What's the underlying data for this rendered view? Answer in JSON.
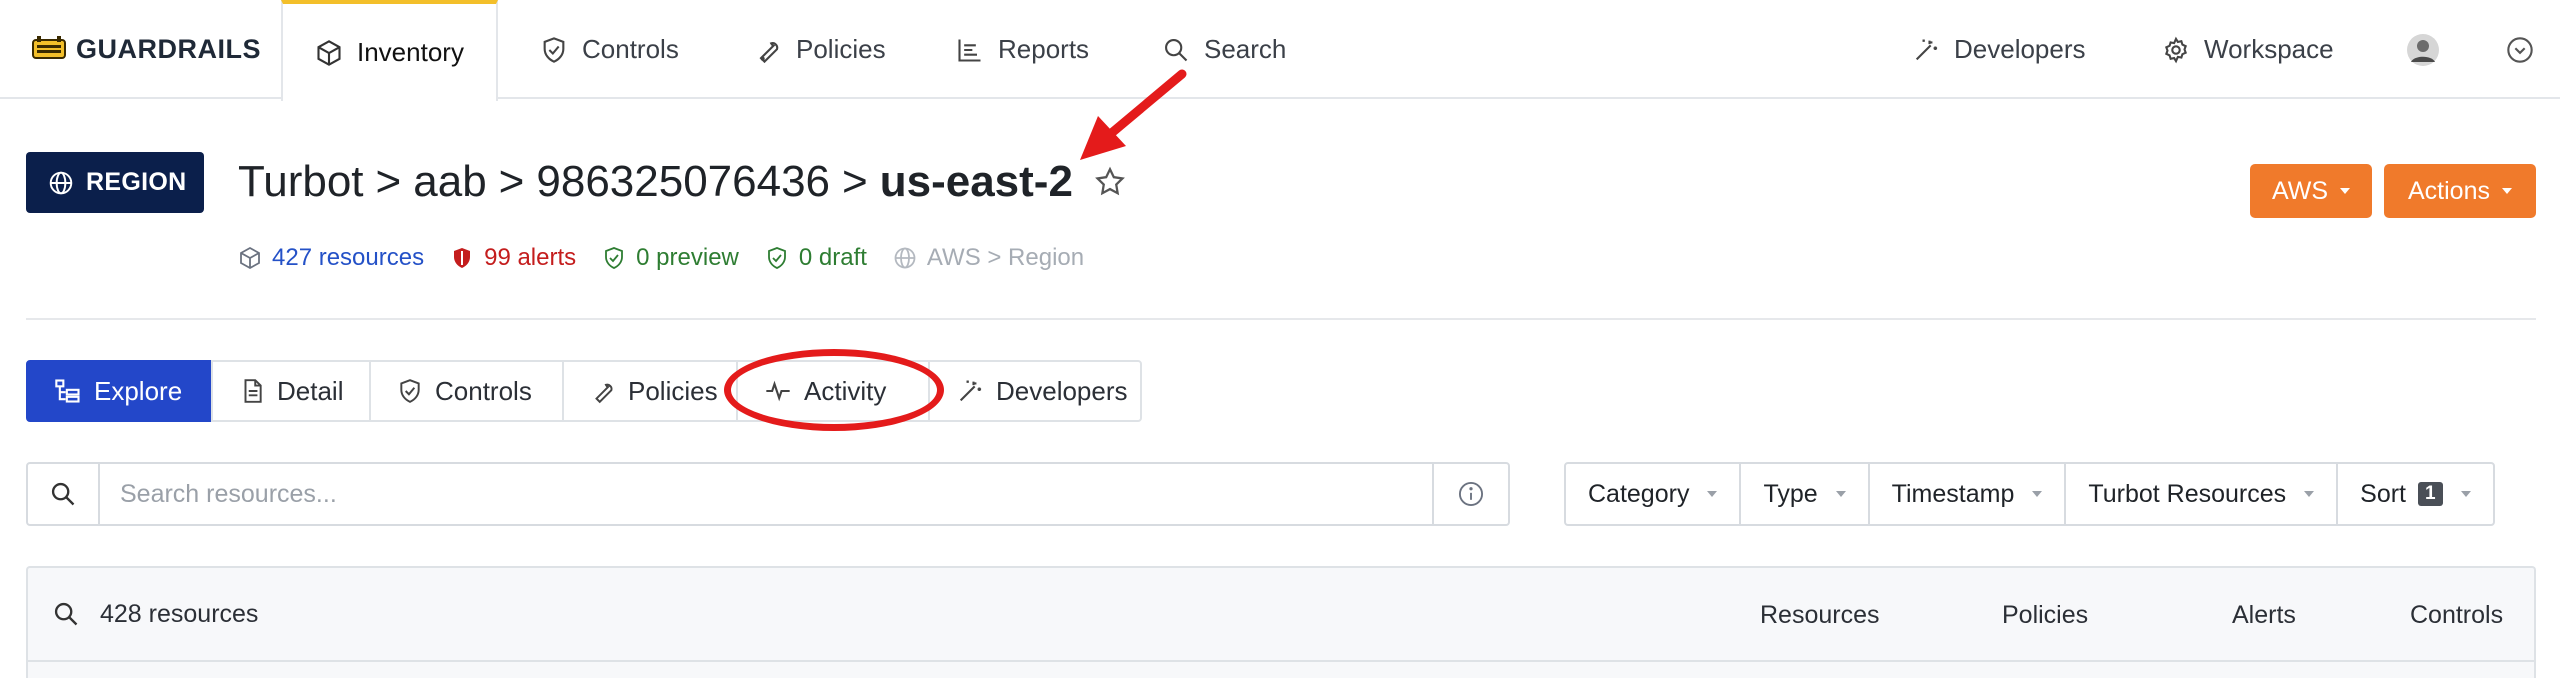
{
  "nav": {
    "brand": "GUARDRAILS",
    "items": [
      {
        "label": "Inventory",
        "icon": "cube-icon"
      },
      {
        "label": "Controls",
        "icon": "shield-check-icon"
      },
      {
        "label": "Policies",
        "icon": "wrench-icon"
      },
      {
        "label": "Reports",
        "icon": "chart-icon"
      },
      {
        "label": "Search",
        "icon": "search-icon"
      }
    ],
    "right": [
      {
        "label": "Developers",
        "icon": "magic-wand-icon"
      },
      {
        "label": "Workspace",
        "icon": "gear-icon"
      }
    ]
  },
  "header": {
    "badge": "REGION",
    "breadcrumb": [
      "Turbot",
      "aab",
      "986325076436"
    ],
    "separator": ">",
    "current": "us-east-2",
    "stats": {
      "resources": "427 resources",
      "alerts": "99 alerts",
      "preview": "0 preview",
      "draft": "0 draft",
      "type": "AWS > Region"
    },
    "buttons": {
      "aws": "AWS",
      "actions": "Actions"
    }
  },
  "tabs": [
    {
      "label": "Explore",
      "icon": "tree-icon",
      "active": true
    },
    {
      "label": "Detail",
      "icon": "document-icon"
    },
    {
      "label": "Controls",
      "icon": "shield-check-icon"
    },
    {
      "label": "Policies",
      "icon": "wrench-icon"
    },
    {
      "label": "Activity",
      "icon": "pulse-icon"
    },
    {
      "label": "Developers",
      "icon": "magic-wand-icon"
    }
  ],
  "search": {
    "placeholder": "Search resources..."
  },
  "filters": {
    "category": "Category",
    "type": "Type",
    "timestamp": "Timestamp",
    "turbot_resources": "Turbot Resources",
    "sort": "Sort",
    "sort_count": "1"
  },
  "results": {
    "count": "428 resources",
    "columns": [
      "Resources",
      "Policies",
      "Alerts",
      "Controls"
    ]
  },
  "colors": {
    "accent_blue": "#2347c9",
    "orange": "#f07a2b",
    "navy": "#0b1f4b",
    "annotation_red": "#e41b1b",
    "brand_yellow": "#f3bf2a"
  }
}
